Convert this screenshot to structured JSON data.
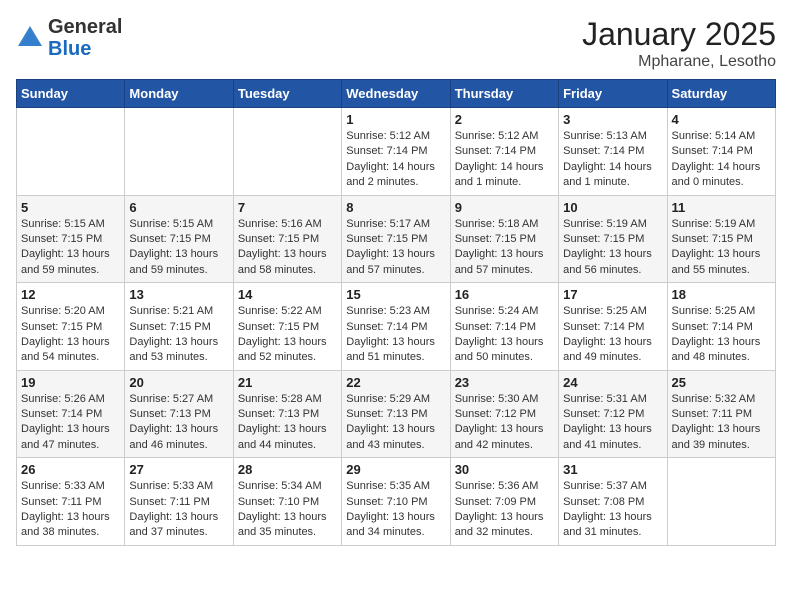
{
  "header": {
    "logo_general": "General",
    "logo_blue": "Blue",
    "month_title": "January 2025",
    "location": "Mpharane, Lesotho"
  },
  "days_of_week": [
    "Sunday",
    "Monday",
    "Tuesday",
    "Wednesday",
    "Thursday",
    "Friday",
    "Saturday"
  ],
  "weeks": [
    [
      {
        "day": "",
        "info": ""
      },
      {
        "day": "",
        "info": ""
      },
      {
        "day": "",
        "info": ""
      },
      {
        "day": "1",
        "info": "Sunrise: 5:12 AM\nSunset: 7:14 PM\nDaylight: 14 hours\nand 2 minutes."
      },
      {
        "day": "2",
        "info": "Sunrise: 5:12 AM\nSunset: 7:14 PM\nDaylight: 14 hours\nand 1 minute."
      },
      {
        "day": "3",
        "info": "Sunrise: 5:13 AM\nSunset: 7:14 PM\nDaylight: 14 hours\nand 1 minute."
      },
      {
        "day": "4",
        "info": "Sunrise: 5:14 AM\nSunset: 7:14 PM\nDaylight: 14 hours\nand 0 minutes."
      }
    ],
    [
      {
        "day": "5",
        "info": "Sunrise: 5:15 AM\nSunset: 7:15 PM\nDaylight: 13 hours\nand 59 minutes."
      },
      {
        "day": "6",
        "info": "Sunrise: 5:15 AM\nSunset: 7:15 PM\nDaylight: 13 hours\nand 59 minutes."
      },
      {
        "day": "7",
        "info": "Sunrise: 5:16 AM\nSunset: 7:15 PM\nDaylight: 13 hours\nand 58 minutes."
      },
      {
        "day": "8",
        "info": "Sunrise: 5:17 AM\nSunset: 7:15 PM\nDaylight: 13 hours\nand 57 minutes."
      },
      {
        "day": "9",
        "info": "Sunrise: 5:18 AM\nSunset: 7:15 PM\nDaylight: 13 hours\nand 57 minutes."
      },
      {
        "day": "10",
        "info": "Sunrise: 5:19 AM\nSunset: 7:15 PM\nDaylight: 13 hours\nand 56 minutes."
      },
      {
        "day": "11",
        "info": "Sunrise: 5:19 AM\nSunset: 7:15 PM\nDaylight: 13 hours\nand 55 minutes."
      }
    ],
    [
      {
        "day": "12",
        "info": "Sunrise: 5:20 AM\nSunset: 7:15 PM\nDaylight: 13 hours\nand 54 minutes."
      },
      {
        "day": "13",
        "info": "Sunrise: 5:21 AM\nSunset: 7:15 PM\nDaylight: 13 hours\nand 53 minutes."
      },
      {
        "day": "14",
        "info": "Sunrise: 5:22 AM\nSunset: 7:15 PM\nDaylight: 13 hours\nand 52 minutes."
      },
      {
        "day": "15",
        "info": "Sunrise: 5:23 AM\nSunset: 7:14 PM\nDaylight: 13 hours\nand 51 minutes."
      },
      {
        "day": "16",
        "info": "Sunrise: 5:24 AM\nSunset: 7:14 PM\nDaylight: 13 hours\nand 50 minutes."
      },
      {
        "day": "17",
        "info": "Sunrise: 5:25 AM\nSunset: 7:14 PM\nDaylight: 13 hours\nand 49 minutes."
      },
      {
        "day": "18",
        "info": "Sunrise: 5:25 AM\nSunset: 7:14 PM\nDaylight: 13 hours\nand 48 minutes."
      }
    ],
    [
      {
        "day": "19",
        "info": "Sunrise: 5:26 AM\nSunset: 7:14 PM\nDaylight: 13 hours\nand 47 minutes."
      },
      {
        "day": "20",
        "info": "Sunrise: 5:27 AM\nSunset: 7:13 PM\nDaylight: 13 hours\nand 46 minutes."
      },
      {
        "day": "21",
        "info": "Sunrise: 5:28 AM\nSunset: 7:13 PM\nDaylight: 13 hours\nand 44 minutes."
      },
      {
        "day": "22",
        "info": "Sunrise: 5:29 AM\nSunset: 7:13 PM\nDaylight: 13 hours\nand 43 minutes."
      },
      {
        "day": "23",
        "info": "Sunrise: 5:30 AM\nSunset: 7:12 PM\nDaylight: 13 hours\nand 42 minutes."
      },
      {
        "day": "24",
        "info": "Sunrise: 5:31 AM\nSunset: 7:12 PM\nDaylight: 13 hours\nand 41 minutes."
      },
      {
        "day": "25",
        "info": "Sunrise: 5:32 AM\nSunset: 7:11 PM\nDaylight: 13 hours\nand 39 minutes."
      }
    ],
    [
      {
        "day": "26",
        "info": "Sunrise: 5:33 AM\nSunset: 7:11 PM\nDaylight: 13 hours\nand 38 minutes."
      },
      {
        "day": "27",
        "info": "Sunrise: 5:33 AM\nSunset: 7:11 PM\nDaylight: 13 hours\nand 37 minutes."
      },
      {
        "day": "28",
        "info": "Sunrise: 5:34 AM\nSunset: 7:10 PM\nDaylight: 13 hours\nand 35 minutes."
      },
      {
        "day": "29",
        "info": "Sunrise: 5:35 AM\nSunset: 7:10 PM\nDaylight: 13 hours\nand 34 minutes."
      },
      {
        "day": "30",
        "info": "Sunrise: 5:36 AM\nSunset: 7:09 PM\nDaylight: 13 hours\nand 32 minutes."
      },
      {
        "day": "31",
        "info": "Sunrise: 5:37 AM\nSunset: 7:08 PM\nDaylight: 13 hours\nand 31 minutes."
      },
      {
        "day": "",
        "info": ""
      }
    ]
  ]
}
